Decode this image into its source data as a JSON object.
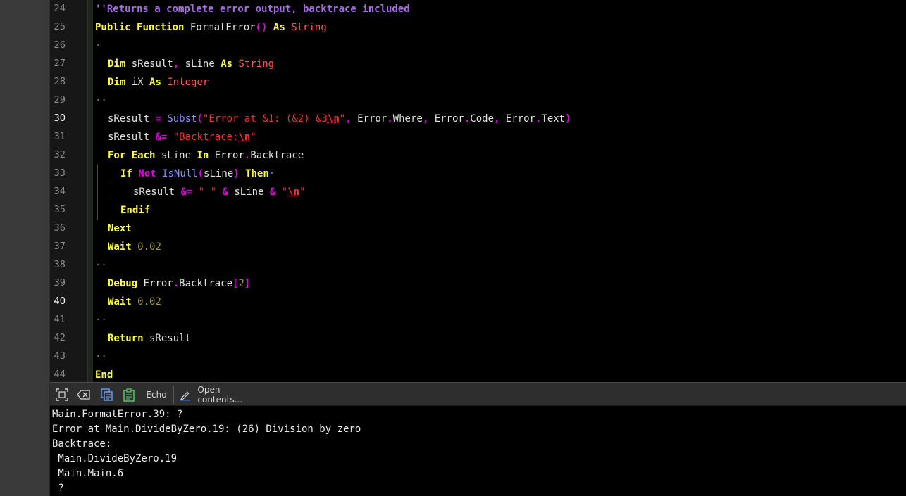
{
  "editor": {
    "current_lines": [
      30,
      40
    ],
    "lines": [
      {
        "n": "24",
        "indent": 0,
        "tokens": [
          [
            "cmt",
            "''Returns a complete error output, backtrace included"
          ]
        ]
      },
      {
        "n": "25",
        "indent": 0,
        "tokens": [
          [
            "kw",
            "Public"
          ],
          [
            "nm",
            " "
          ],
          [
            "kw",
            "Function"
          ],
          [
            "nm",
            " FormatError"
          ],
          [
            "op",
            "()"
          ],
          [
            "nm",
            " "
          ],
          [
            "kw",
            "As"
          ],
          [
            "nm",
            " "
          ],
          [
            "ty",
            "String"
          ]
        ]
      },
      {
        "n": "26",
        "indent": 0,
        "tokens": [
          [
            "ws",
            "·"
          ]
        ]
      },
      {
        "n": "27",
        "indent": 1,
        "tokens": [
          [
            "kw",
            "Dim"
          ],
          [
            "nm",
            " sResult"
          ],
          [
            "op",
            ","
          ],
          [
            "nm",
            " sLine "
          ],
          [
            "kw",
            "As"
          ],
          [
            "nm",
            " "
          ],
          [
            "ty",
            "String"
          ]
        ]
      },
      {
        "n": "28",
        "indent": 1,
        "tokens": [
          [
            "kw",
            "Dim"
          ],
          [
            "nm",
            " iX "
          ],
          [
            "kw",
            "As"
          ],
          [
            "nm",
            " "
          ],
          [
            "ty",
            "Integer"
          ]
        ]
      },
      {
        "n": "29",
        "indent": 0,
        "tokens": [
          [
            "ws",
            "··"
          ]
        ]
      },
      {
        "n": "30",
        "indent": 1,
        "tokens": [
          [
            "nm",
            "sResult "
          ],
          [
            "op",
            "="
          ],
          [
            "nm",
            " "
          ],
          [
            "fn",
            "Subst"
          ],
          [
            "op",
            "("
          ],
          [
            "str",
            "\"Error at &1: (&2) &3"
          ],
          [
            "esc",
            "\\n"
          ],
          [
            "str",
            "\""
          ],
          [
            "op",
            ","
          ],
          [
            "nm",
            " Error"
          ],
          [
            "op",
            "."
          ],
          [
            "nm",
            "Where"
          ],
          [
            "op",
            ","
          ],
          [
            "nm",
            " Error"
          ],
          [
            "op",
            "."
          ],
          [
            "nm",
            "Code"
          ],
          [
            "op",
            ","
          ],
          [
            "nm",
            " Error"
          ],
          [
            "op",
            "."
          ],
          [
            "nm",
            "Text"
          ],
          [
            "op",
            ")"
          ]
        ]
      },
      {
        "n": "31",
        "indent": 1,
        "tokens": [
          [
            "nm",
            "sResult "
          ],
          [
            "op",
            "&="
          ],
          [
            "nm",
            " "
          ],
          [
            "str",
            "\"Backtrace:"
          ],
          [
            "esc",
            "\\n"
          ],
          [
            "str",
            "\""
          ]
        ]
      },
      {
        "n": "32",
        "indent": 1,
        "tokens": [
          [
            "kw",
            "For"
          ],
          [
            "nm",
            " "
          ],
          [
            "kw",
            "Each"
          ],
          [
            "nm",
            " sLine "
          ],
          [
            "kw",
            "In"
          ],
          [
            "nm",
            " Error"
          ],
          [
            "op",
            "."
          ],
          [
            "nm",
            "Backtrace"
          ]
        ]
      },
      {
        "n": "33",
        "indent": 2,
        "tokens": [
          [
            "kw",
            "If"
          ],
          [
            "nm",
            " "
          ],
          [
            "op",
            "Not"
          ],
          [
            "nm",
            " "
          ],
          [
            "fn",
            "IsNull"
          ],
          [
            "op",
            "("
          ],
          [
            "nm",
            "sLine"
          ],
          [
            "op",
            ")"
          ],
          [
            "nm",
            " "
          ],
          [
            "kw",
            "Then"
          ],
          [
            "ws",
            "·"
          ]
        ]
      },
      {
        "n": "34",
        "indent": 3,
        "tokens": [
          [
            "nm",
            "sResult "
          ],
          [
            "op",
            "&="
          ],
          [
            "nm",
            " "
          ],
          [
            "str",
            "\" \""
          ],
          [
            "nm",
            " "
          ],
          [
            "op",
            "&"
          ],
          [
            "nm",
            " sLine "
          ],
          [
            "op",
            "&"
          ],
          [
            "nm",
            " "
          ],
          [
            "str",
            "\""
          ],
          [
            "esc",
            "\\n"
          ],
          [
            "str",
            "\""
          ]
        ]
      },
      {
        "n": "35",
        "indent": 2,
        "tokens": [
          [
            "kw",
            "Endif"
          ]
        ]
      },
      {
        "n": "36",
        "indent": 1,
        "tokens": [
          [
            "kw",
            "Next"
          ]
        ]
      },
      {
        "n": "37",
        "indent": 1,
        "tokens": [
          [
            "kw",
            "Wait"
          ],
          [
            "nm",
            " "
          ],
          [
            "num",
            "0.02"
          ]
        ]
      },
      {
        "n": "38",
        "indent": 0,
        "tokens": [
          [
            "ws",
            "··"
          ]
        ]
      },
      {
        "n": "39",
        "indent": 1,
        "tokens": [
          [
            "kw",
            "Debug"
          ],
          [
            "nm",
            " Error"
          ],
          [
            "op",
            "."
          ],
          [
            "nm",
            "Backtrace"
          ],
          [
            "op",
            "["
          ],
          [
            "num",
            "2"
          ],
          [
            "op",
            "]"
          ]
        ]
      },
      {
        "n": "40",
        "indent": 1,
        "tokens": [
          [
            "kw",
            "Wait"
          ],
          [
            "nm",
            " "
          ],
          [
            "num",
            "0.02"
          ]
        ]
      },
      {
        "n": "41",
        "indent": 0,
        "tokens": [
          [
            "ws",
            "··"
          ]
        ]
      },
      {
        "n": "42",
        "indent": 1,
        "tokens": [
          [
            "kw",
            "Return"
          ],
          [
            "nm",
            " sResult"
          ]
        ]
      },
      {
        "n": "43",
        "indent": 0,
        "tokens": [
          [
            "ws",
            "··"
          ]
        ]
      },
      {
        "n": "44",
        "indent": 0,
        "tokens": [
          [
            "kw",
            "End"
          ]
        ]
      }
    ]
  },
  "toolbar": {
    "echo_label": "Echo",
    "open_contents_label": "Open contents..."
  },
  "console": {
    "lines": [
      "Main.FormatError.39: ?",
      "Error at Main.DivideByZero.19: (26) Division by zero",
      "Backtrace:",
      " Main.DivideByZero.19",
      " Main.Main.6",
      " ?"
    ]
  },
  "icons": {
    "fit": "fit-view-icon",
    "clear": "clear-icon",
    "copy": "copy-icon",
    "paste": "paste-icon",
    "open": "pencil-icon"
  }
}
